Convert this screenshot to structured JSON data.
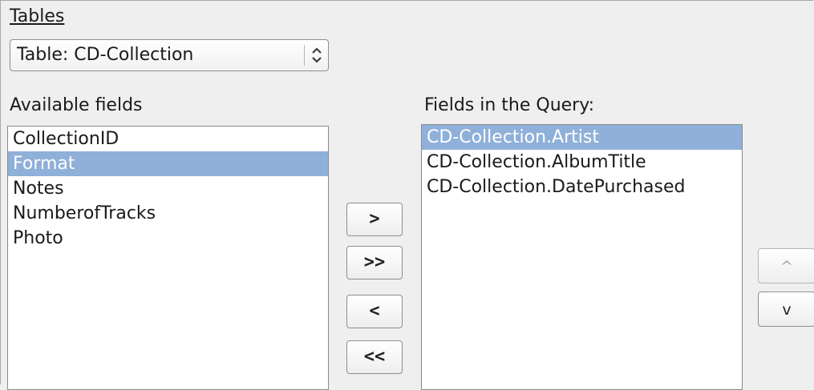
{
  "tables": {
    "label": "Tables",
    "selected": "Table: CD-Collection"
  },
  "available": {
    "label": "Available fields",
    "items": [
      "CollectionID",
      "Format",
      "Notes",
      "NumberofTracks",
      "Photo"
    ],
    "selected_index": 1
  },
  "query": {
    "label": "Fields in the Query:",
    "items": [
      "CD-Collection.Artist",
      "CD-Collection.AlbumTitle",
      "CD-Collection.DatePurchased"
    ],
    "selected_index": 0
  },
  "transfer_buttons": {
    "add_one": ">",
    "add_all": ">>",
    "remove_one": "<",
    "remove_all": "<<"
  },
  "order_buttons": {
    "up": "^",
    "down": "v"
  },
  "icons": {
    "combo_arrows": "updown-chevron-icon"
  }
}
